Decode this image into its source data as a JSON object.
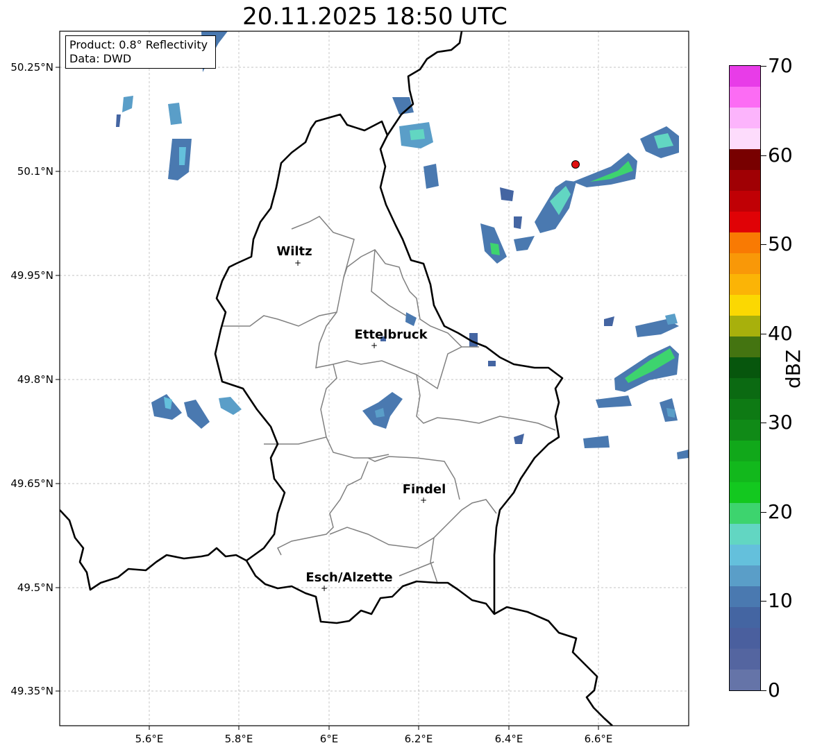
{
  "title": "20.11.2025 18:50 UTC",
  "info_box": {
    "product": "Product: 0.8° Reflectivity",
    "data": "Data: DWD"
  },
  "axes": {
    "lon_ticks": [
      "5.6°E",
      "5.8°E",
      "6°E",
      "6.2°E",
      "6.4°E",
      "6.6°E"
    ],
    "lat_ticks": [
      "50.25°N",
      "50.1°N",
      "49.95°N",
      "49.8°N",
      "49.65°N",
      "49.5°N",
      "49.35°N"
    ]
  },
  "cities": [
    {
      "name": "Wiltz",
      "lon": 5.93,
      "lat": 49.967
    },
    {
      "name": "Ettelbruck",
      "lon": 6.1,
      "lat": 49.848
    },
    {
      "name": "Findel",
      "lon": 6.21,
      "lat": 49.627
    },
    {
      "name": "Esch/Alzette",
      "lon": 5.99,
      "lat": 49.498
    }
  ],
  "radar_marker": {
    "lon": 6.55,
    "lat": 50.11,
    "color": "#e01010"
  },
  "colorbar": {
    "unit": "dBZ",
    "min": 0,
    "max": 70,
    "tick_labels": [
      "0",
      "10",
      "20",
      "30",
      "40",
      "50",
      "60",
      "70"
    ],
    "colors": [
      "#6574a8",
      "#5465a0",
      "#4a5f9e",
      "#4465a2",
      "#4a79b0",
      "#5a9ec8",
      "#64c0dc",
      "#62d6c2",
      "#3dd46e",
      "#13c81f",
      "#12b81c",
      "#11a81a",
      "#108a17",
      "#0e7a14",
      "#0b6a12",
      "#07560d",
      "#447411",
      "#a8b00c",
      "#fbd802",
      "#fbb406",
      "#f99808",
      "#f97a03",
      "#e00206",
      "#c00005",
      "#a00004",
      "#780000",
      "#fddcfc",
      "#fcb4fc",
      "#fc6cf4",
      "#e83ce8"
    ]
  },
  "colors": {
    "country_border": "#000000",
    "canton_border": "#808080",
    "grid": "#b0b0b0"
  }
}
